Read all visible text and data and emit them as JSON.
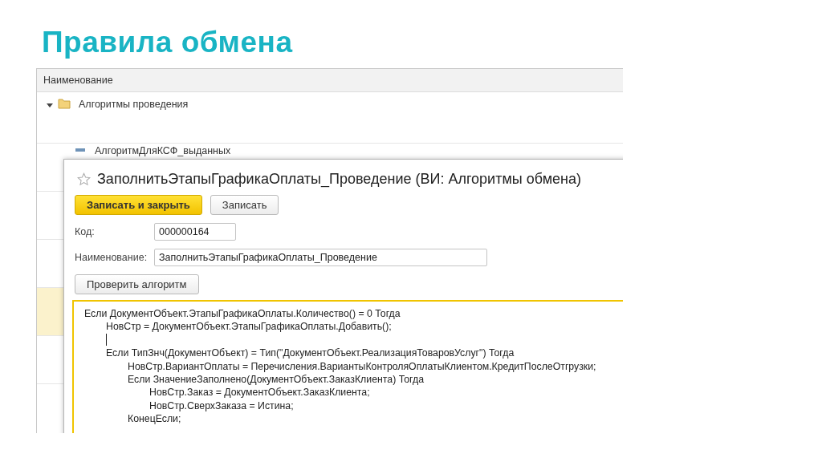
{
  "slide_title": "Правила обмена",
  "list": {
    "column": "Наименование",
    "items": [
      {
        "label": "Алгоритмы проведения",
        "expanded": true,
        "children": [
          {
            "label": "АлгоритмДляКСФ_выданных",
            "selected": false
          },
          {
            "selected": false
          },
          {
            "selected": false
          },
          {
            "selected": true
          },
          {
            "selected": false
          }
        ]
      }
    ]
  },
  "dialog": {
    "title": "ЗаполнитьЭтапыГрафикаОплаты_Проведение (ВИ: Алгоритмы обмена)",
    "favorite": false,
    "buttons": [
      {
        "label": "Записать и закрыть",
        "kind": "primary"
      },
      {
        "label": "Записать",
        "kind": "normal"
      }
    ],
    "fields": [
      {
        "label": "Код:",
        "value": "000000164",
        "kind": "short"
      },
      {
        "label": "Наименование:",
        "value": "ЗаполнитьЭтапыГрафикаОплаты_Проведение",
        "kind": "long"
      }
    ],
    "check_button": "Проверить алгоритм",
    "code": [
      {
        "text": "Если ДокументОбъект.ЭтапыГрафикаОплаты.Количество() = 0 Тогда",
        "children": [
          {
            "text": "НовСтр = ДокументОбъект.ЭтапыГрафикаОплаты.Добавить();"
          },
          {
            "kind": "cursor"
          },
          {
            "text": "Если ТипЗнч(ДокументОбъект) = Тип(\"ДокументОбъект.РеализацияТоваровУслуг\") Тогда",
            "children": [
              {
                "text": "НовСтр.ВариантОплаты = Перечисления.ВариантыКонтроляОплатыКлиентом.КредитПослеОтгрузки;"
              },
              {
                "text": "Если ЗначениеЗаполнено(ДокументОбъект.ЗаказКлиента) Тогда",
                "children": [
                  {
                    "text": "НовСтр.Заказ = ДокументОбъект.ЗаказКлиента;"
                  },
                  {
                    "text": "НовСтр.СверхЗаказа = Истина;"
                  }
                ]
              },
              {
                "text": "КонецЕсли;"
              }
            ]
          }
        ]
      }
    ]
  }
}
